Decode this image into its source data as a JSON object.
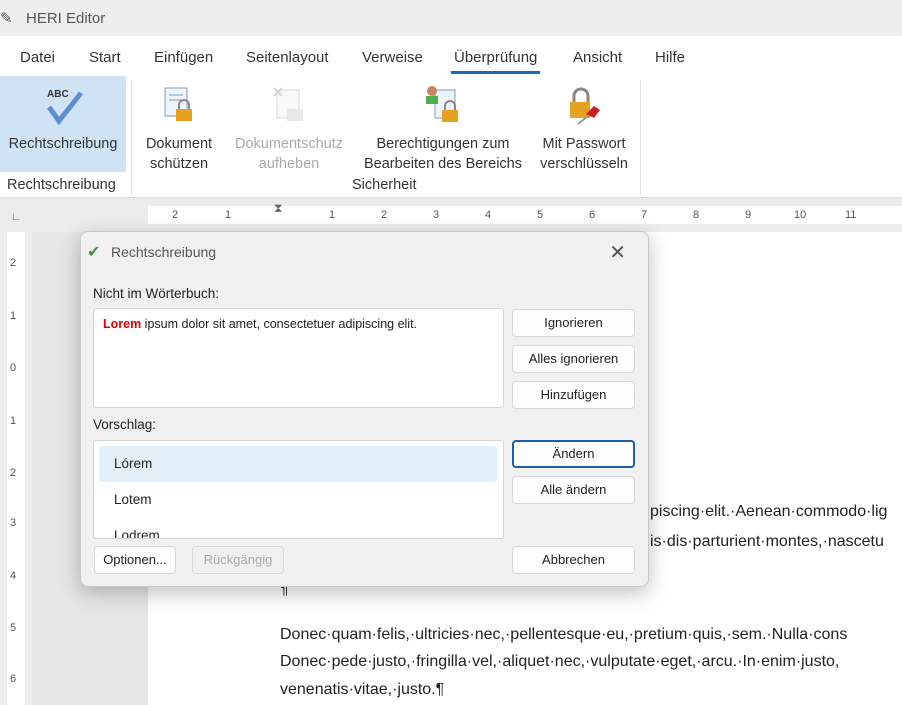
{
  "app": {
    "title": "HERI Editor",
    "icon": "editor-icon"
  },
  "menu": [
    "Datei",
    "Start",
    "Einfügen",
    "Seitenlayout",
    "Verweise",
    "Überprüfung",
    "Ansicht",
    "Hilfe"
  ],
  "menu_active": "Überprüfung",
  "ribbon": {
    "spelling": {
      "label": "Rechtschreibung",
      "icon": "abc-check-icon",
      "group": "Rechtschreibung"
    },
    "protect": {
      "line1": "Dokument",
      "line2": "schützen",
      "icon": "document-lock-icon"
    },
    "unprotect": {
      "line1": "Dokumentschutz",
      "line2": "aufheben",
      "icon": "document-unlock-icon",
      "disabled": true
    },
    "permissions": {
      "line1": "Berechtigungen zum",
      "line2": "Bearbeiten des Bereichs",
      "icon": "user-lock-icon"
    },
    "encrypt": {
      "line1": "Mit Passwort",
      "line2": "verschlüsseln",
      "icon": "lock-key-icon"
    },
    "security_group": "Sicherheit"
  },
  "ruler": {
    "h": [
      "2",
      "1",
      "1",
      "2",
      "3",
      "4",
      "5",
      "6",
      "7",
      "8",
      "9",
      "10",
      "11"
    ],
    "v": [
      "2",
      "1",
      "0",
      "1",
      "2",
      "3",
      "4",
      "5",
      "6"
    ]
  },
  "document": {
    "lines": [
      "piscing·elit.·Aenean·commodo·lig",
      "is·dis·parturient·montes,·nascetu",
      "¶",
      "Donec·quam·felis,·ultricies·nec,·pellentesque·eu,·pretium·quis,·sem.·Nulla·cons",
      "Donec·pede·justo,·fringilla·vel,·aliquet·nec,·vulputate·eget,·arcu.·In·enim·justo,",
      "venenatis·vitae,·justo.¶"
    ]
  },
  "dialog": {
    "title": "Rechtschreibung",
    "not_in_dict_label": "Nicht im Wörterbuch:",
    "error_word": "Lorem",
    "sentence_rest": " ipsum dolor sit amet, consectetuer adipiscing elit.",
    "error_color": "#e00000",
    "suggestion_label": "Vorschlag:",
    "suggestions": [
      "Lórem",
      "Lotem",
      "Lodrem"
    ],
    "selected_suggestion": "Lórem",
    "buttons": {
      "ignore": "Ignorieren",
      "ignore_all": "Alles ignorieren",
      "add": "Hinzufügen",
      "change": "Ändern",
      "change_all": "Alle ändern",
      "options": "Optionen...",
      "undo": "Rückgängig",
      "cancel": "Abbrechen"
    }
  }
}
